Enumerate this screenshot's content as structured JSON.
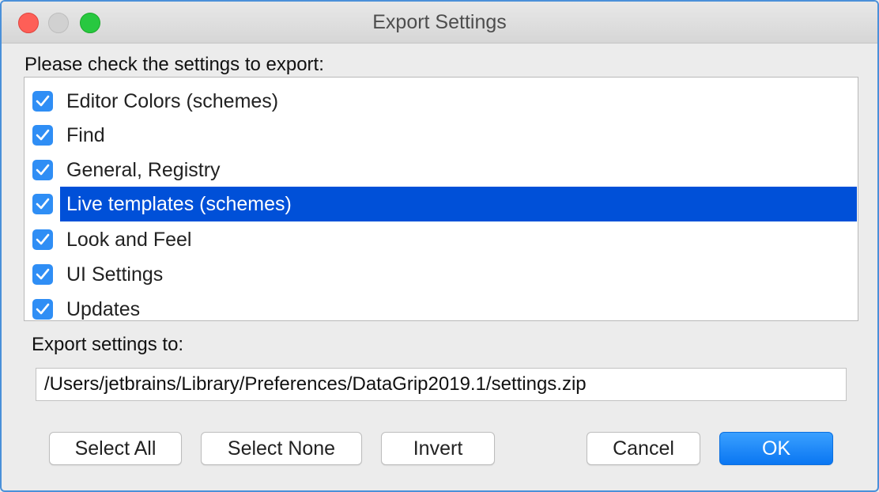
{
  "window": {
    "title": "Export Settings"
  },
  "prompt": "Please check the settings to export:",
  "settings_items": [
    {
      "label": "Editor Colors (schemes)",
      "checked": true,
      "selected": false
    },
    {
      "label": "Find",
      "checked": true,
      "selected": false
    },
    {
      "label": "General, Registry",
      "checked": true,
      "selected": false
    },
    {
      "label": "Live templates (schemes)",
      "checked": true,
      "selected": true
    },
    {
      "label": "Look and Feel",
      "checked": true,
      "selected": false
    },
    {
      "label": "UI Settings",
      "checked": true,
      "selected": false
    },
    {
      "label": "Updates",
      "checked": true,
      "selected": false
    }
  ],
  "export": {
    "label": "Export settings to:",
    "path": "/Users/jetbrains/Library/Preferences/DataGrip2019.1/settings.zip"
  },
  "buttons": {
    "select_all": "Select All",
    "select_none": "Select None",
    "invert": "Invert",
    "cancel": "Cancel",
    "ok": "OK"
  },
  "colors": {
    "checkbox": "#2f8ef5",
    "selection": "#0050d8",
    "primary_button": "#0a76f2"
  }
}
